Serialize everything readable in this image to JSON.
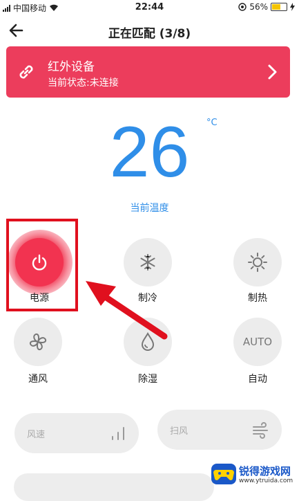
{
  "status_bar": {
    "carrier": "中国移动",
    "time": "22:44",
    "battery_percent": "56%"
  },
  "header": {
    "title": "正在匹配 (3/8)"
  },
  "device_card": {
    "title": "红外设备",
    "status": "当前状态:未连接",
    "background": "#ec3d5c"
  },
  "temperature": {
    "value": "26",
    "unit": "°C",
    "label": "当前温度"
  },
  "modes": [
    {
      "label": "电源",
      "icon": "power-icon"
    },
    {
      "label": "制冷",
      "icon": "snowflake-icon"
    },
    {
      "label": "制热",
      "icon": "sun-icon"
    },
    {
      "label": "通风",
      "icon": "fan-icon"
    },
    {
      "label": "除湿",
      "icon": "droplet-icon"
    },
    {
      "label": "自动",
      "icon_text": "AUTO"
    }
  ],
  "controls": {
    "fan_speed": {
      "label": "风速",
      "icon": "signal-bars-icon"
    },
    "swing": {
      "label": "扫风",
      "icon": "wind-icon"
    }
  },
  "watermark": {
    "title": "锐得游戏网",
    "url": "www.ytruida.com"
  },
  "colors": {
    "accent": "#f23350",
    "temperature": "#2f8ee8",
    "highlight_box": "#e0101e"
  }
}
